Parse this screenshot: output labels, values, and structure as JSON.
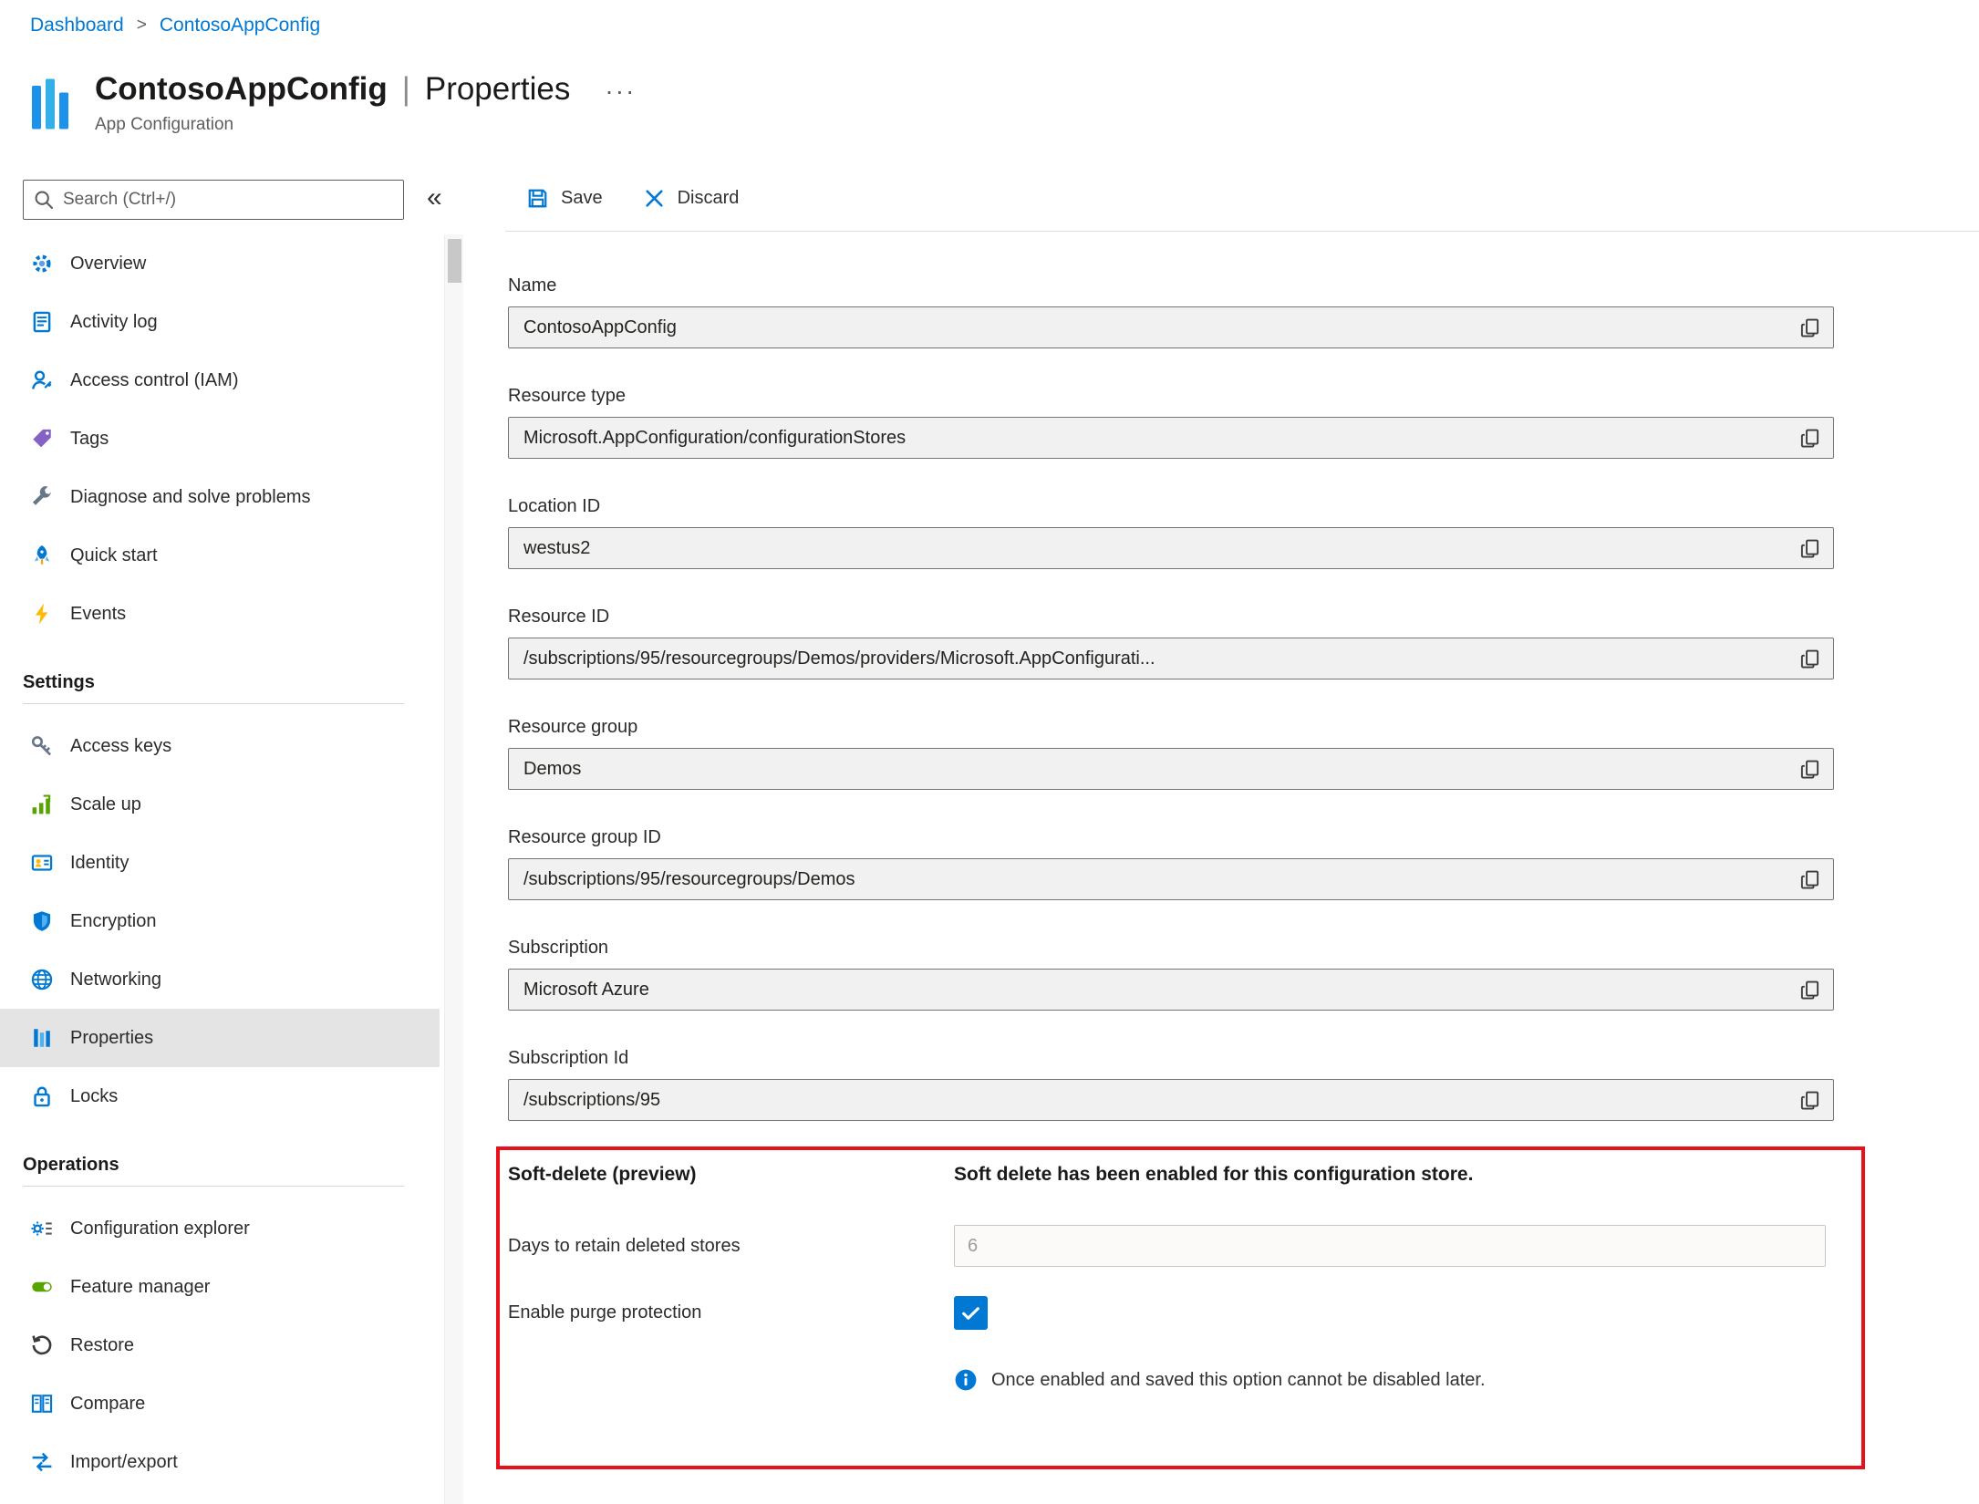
{
  "breadcrumb": {
    "items": [
      "Dashboard",
      "ContosoAppConfig"
    ],
    "separator": ">"
  },
  "header": {
    "title": "ContosoAppConfig",
    "separator": "|",
    "blade": "Properties",
    "more_label": "···",
    "subtitle": "App Configuration",
    "resource_icon": "app-configuration-bars-icon"
  },
  "toolbar": {
    "save": "Save",
    "discard": "Discard"
  },
  "sidebar": {
    "search_placeholder": "Search (Ctrl+/)",
    "collapse_glyph": "«",
    "items": [
      {
        "label": "Overview",
        "icon": "overview-gear-icon"
      },
      {
        "label": "Activity log",
        "icon": "activity-log-icon"
      },
      {
        "label": "Access control (IAM)",
        "icon": "access-control-person-icon"
      },
      {
        "label": "Tags",
        "icon": "tag-icon"
      },
      {
        "label": "Diagnose and solve problems",
        "icon": "wrench-icon"
      },
      {
        "label": "Quick start",
        "icon": "rocket-icon"
      },
      {
        "label": "Events",
        "icon": "lightning-icon"
      }
    ],
    "settings_header": "Settings",
    "settings_items": [
      {
        "label": "Access keys",
        "icon": "key-icon"
      },
      {
        "label": "Scale up",
        "icon": "scale-up-bars-icon"
      },
      {
        "label": "Identity",
        "icon": "identity-card-icon"
      },
      {
        "label": "Encryption",
        "icon": "shield-icon"
      },
      {
        "label": "Networking",
        "icon": "globe-icon"
      },
      {
        "label": "Properties",
        "icon": "properties-bars-icon",
        "selected": true
      },
      {
        "label": "Locks",
        "icon": "lock-icon"
      }
    ],
    "operations_header": "Operations",
    "operations_items": [
      {
        "label": "Configuration explorer",
        "icon": "gear-list-icon"
      },
      {
        "label": "Feature manager",
        "icon": "toggle-icon"
      },
      {
        "label": "Restore",
        "icon": "restore-arrow-icon"
      },
      {
        "label": "Compare",
        "icon": "compare-docs-icon"
      },
      {
        "label": "Import/export",
        "icon": "import-export-arrows-icon"
      }
    ]
  },
  "fields": [
    {
      "label": "Name",
      "value": "ContosoAppConfig"
    },
    {
      "label": "Resource type",
      "value": "Microsoft.AppConfiguration/configurationStores"
    },
    {
      "label": "Location ID",
      "value": "westus2"
    },
    {
      "label": "Resource ID",
      "value": "/subscriptions/95/resourcegroups/Demos/providers/Microsoft.AppConfigurati..."
    },
    {
      "label": "Resource group",
      "value": "Demos"
    },
    {
      "label": "Resource group ID",
      "value": "/subscriptions/95/resourcegroups/Demos"
    },
    {
      "label": "Subscription",
      "value": "Microsoft Azure"
    },
    {
      "label": "Subscription Id",
      "value": "/subscriptions/95"
    }
  ],
  "soft_delete": {
    "heading": "Soft-delete (preview)",
    "status": "Soft delete has been enabled for this configuration store.",
    "days_label": "Days to retain deleted stores",
    "days_value": "6",
    "purge_label": "Enable purge protection",
    "purge_checked": true,
    "info_text": "Once enabled and saved this option cannot be disabled later."
  },
  "colors": {
    "link": "#0078d4",
    "accent": "#0078d4",
    "selected_bg": "#e4e4e4",
    "field_bg": "#f1f1f1",
    "field_border": "#757575",
    "alert_border": "#e8101c",
    "checkbox": "#0078d4"
  }
}
